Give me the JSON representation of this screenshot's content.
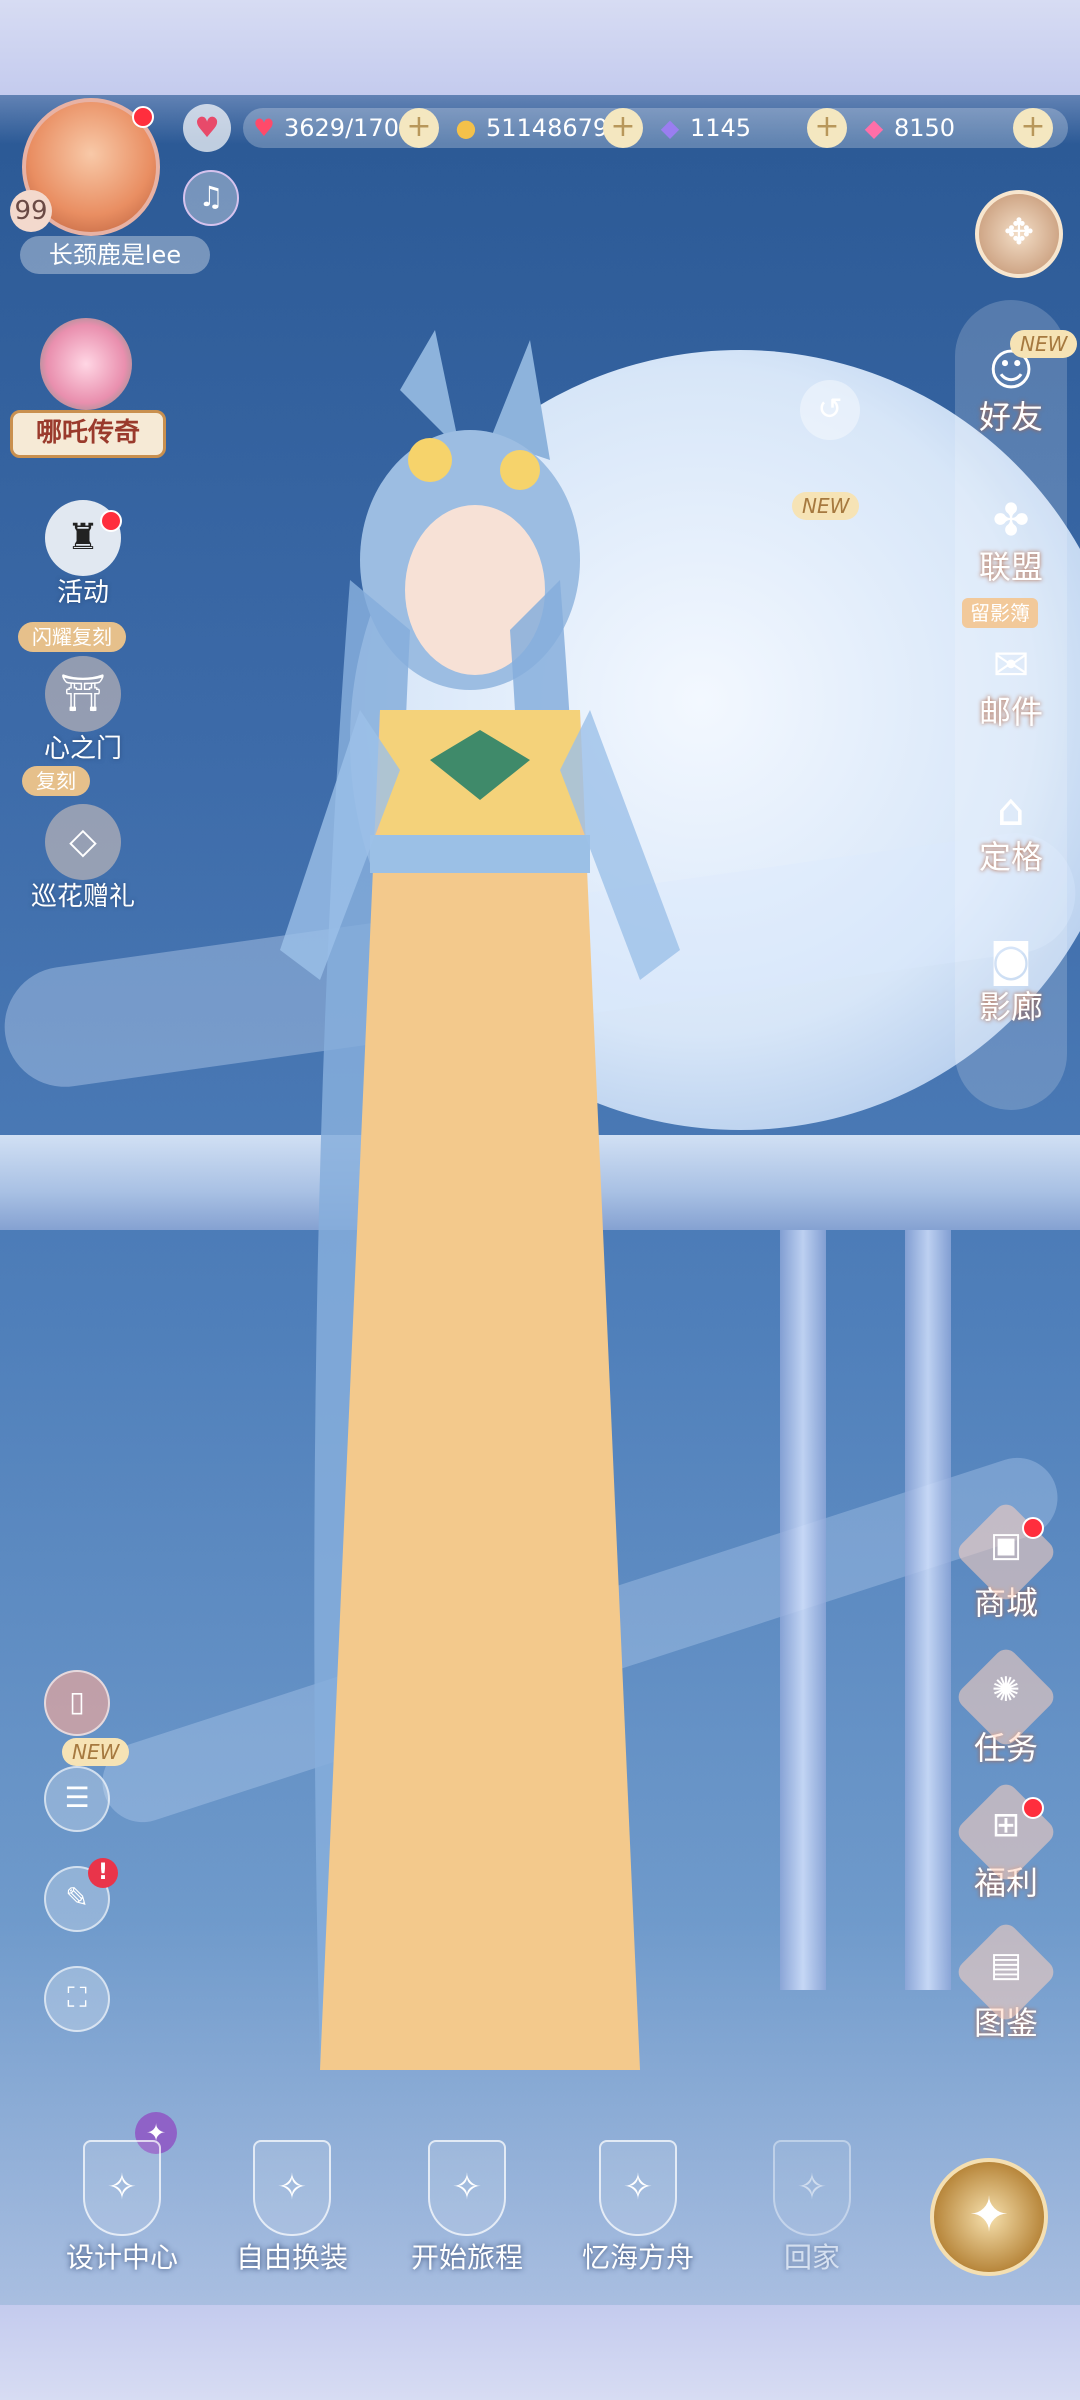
{
  "player": {
    "level": "99",
    "name": "长颈鹿是lee"
  },
  "resources": {
    "stamina": "3629/170",
    "coins": "51148679",
    "diamonds": "1145",
    "pink_diamonds": "8150"
  },
  "tags": {
    "new": "NEW"
  },
  "event": {
    "banner": "哪吒传奇"
  },
  "left_menu": [
    {
      "label": "活动",
      "tag": "闪耀复刻"
    },
    {
      "label": "心之门",
      "tag": "复刻"
    },
    {
      "label": "巡花赠礼",
      "tag": ""
    }
  ],
  "right_menu": [
    {
      "label": "好友",
      "tag": "NEW"
    },
    {
      "label": "联盟",
      "tag": "留影簿"
    },
    {
      "label": "邮件",
      "tag": ""
    },
    {
      "label": "定格",
      "tag": ""
    },
    {
      "label": "影廊",
      "tag": ""
    }
  ],
  "right_lower_menu": [
    {
      "label": "商城"
    },
    {
      "label": "任务"
    },
    {
      "label": "福利"
    },
    {
      "label": "图鉴"
    }
  ],
  "bottom_nav": [
    {
      "label": "设计中心"
    },
    {
      "label": "自由换装"
    },
    {
      "label": "开始旅程"
    },
    {
      "label": "忆海方舟"
    },
    {
      "label": "回家"
    }
  ],
  "icons": {
    "heart": "heart-icon",
    "music": "music-note-icon",
    "gift": "gift-icon"
  }
}
